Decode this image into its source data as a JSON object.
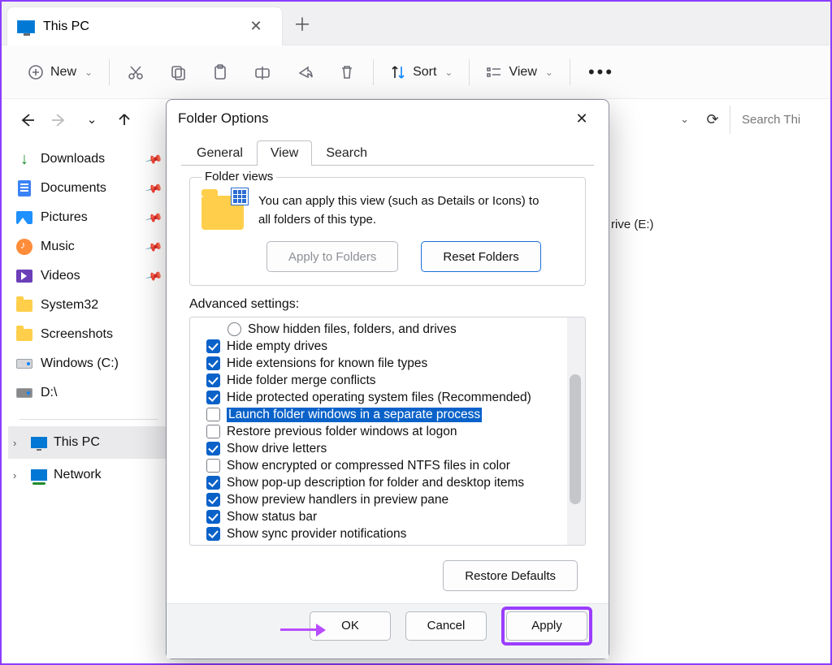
{
  "tab": {
    "title": "This PC"
  },
  "toolbar": {
    "new": "New",
    "sort": "Sort",
    "view": "View"
  },
  "search": {
    "placeholder": "Search Thi"
  },
  "sidebar": {
    "items": [
      {
        "label": "Downloads",
        "pinned": true
      },
      {
        "label": "Documents",
        "pinned": true
      },
      {
        "label": "Pictures",
        "pinned": true
      },
      {
        "label": "Music",
        "pinned": true
      },
      {
        "label": "Videos",
        "pinned": true
      },
      {
        "label": "System32",
        "pinned": false
      },
      {
        "label": "Screenshots",
        "pinned": false
      },
      {
        "label": "Windows (C:)",
        "pinned": false
      },
      {
        "label": "D:\\",
        "pinned": false
      }
    ],
    "tree": [
      {
        "label": "This PC",
        "selected": true
      },
      {
        "label": "Network",
        "selected": false
      }
    ]
  },
  "content": {
    "drive_e": "rive (E:)"
  },
  "dialog": {
    "title": "Folder Options",
    "tabs": {
      "general": "General",
      "view": "View",
      "search": "Search"
    },
    "folder_views": {
      "legend": "Folder views",
      "text1": "You can apply this view (such as Details or Icons) to",
      "text2": "all folders of this type.",
      "apply_btn": "Apply to Folders",
      "reset_btn": "Reset Folders"
    },
    "advanced": {
      "label": "Advanced settings:",
      "items": [
        {
          "type": "radio",
          "checked": false,
          "label": "Show hidden files, folders, and drives"
        },
        {
          "type": "check",
          "checked": true,
          "label": "Hide empty drives"
        },
        {
          "type": "check",
          "checked": true,
          "label": "Hide extensions for known file types"
        },
        {
          "type": "check",
          "checked": true,
          "label": "Hide folder merge conflicts"
        },
        {
          "type": "check",
          "checked": true,
          "label": "Hide protected operating system files (Recommended)"
        },
        {
          "type": "check",
          "checked": false,
          "label": "Launch folder windows in a separate process",
          "selected": true
        },
        {
          "type": "check",
          "checked": false,
          "label": "Restore previous folder windows at logon"
        },
        {
          "type": "check",
          "checked": true,
          "label": "Show drive letters"
        },
        {
          "type": "check",
          "checked": false,
          "label": "Show encrypted or compressed NTFS files in color"
        },
        {
          "type": "check",
          "checked": true,
          "label": "Show pop-up description for folder and desktop items"
        },
        {
          "type": "check",
          "checked": true,
          "label": "Show preview handlers in preview pane"
        },
        {
          "type": "check",
          "checked": true,
          "label": "Show status bar"
        },
        {
          "type": "check",
          "checked": true,
          "label": "Show sync provider notifications"
        }
      ],
      "restore_btn": "Restore Defaults"
    },
    "footer": {
      "ok": "OK",
      "cancel": "Cancel",
      "apply": "Apply"
    }
  }
}
